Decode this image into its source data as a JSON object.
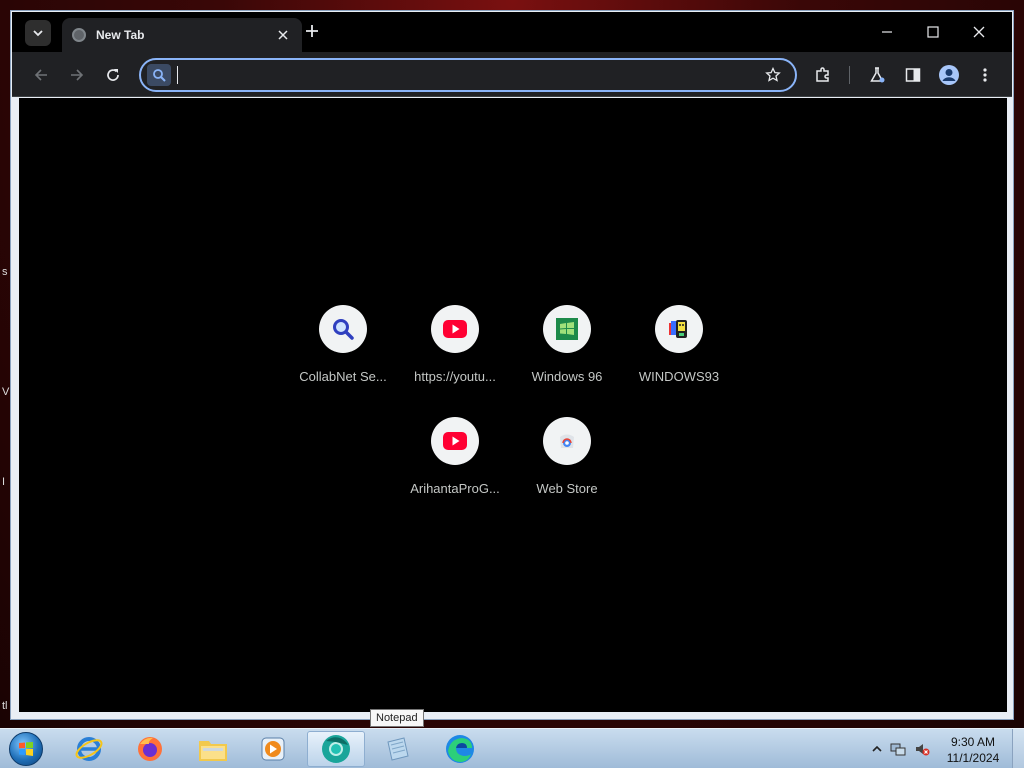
{
  "browser": {
    "tab": {
      "title": "New Tab"
    },
    "omnibox": {
      "value": "",
      "placeholder": ""
    }
  },
  "shortcuts": [
    {
      "label": "CollabNet Se...",
      "icon": "magnifier-icon"
    },
    {
      "label": "https://youtu...",
      "icon": "youtube-icon"
    },
    {
      "label": "Windows 96",
      "icon": "windows96-logo-icon"
    },
    {
      "label": "WINDOWS93",
      "icon": "windows93-logo-icon"
    },
    {
      "label": "ArihantaProG...",
      "icon": "youtube-icon"
    },
    {
      "label": "Web Store",
      "icon": "webstore-icon"
    }
  ],
  "taskbar": {
    "tooltip": "Notepad",
    "clock": {
      "time": "9:30 AM",
      "date": "11/1/2024"
    }
  },
  "desktop": {
    "edge_text": [
      "s",
      "V",
      "I",
      "tl"
    ]
  },
  "colors": {
    "accent": "#8ab4f8",
    "chrome_dark": "#202124",
    "youtube_red": "#ff0033",
    "taskbar": "#b6cde4"
  }
}
